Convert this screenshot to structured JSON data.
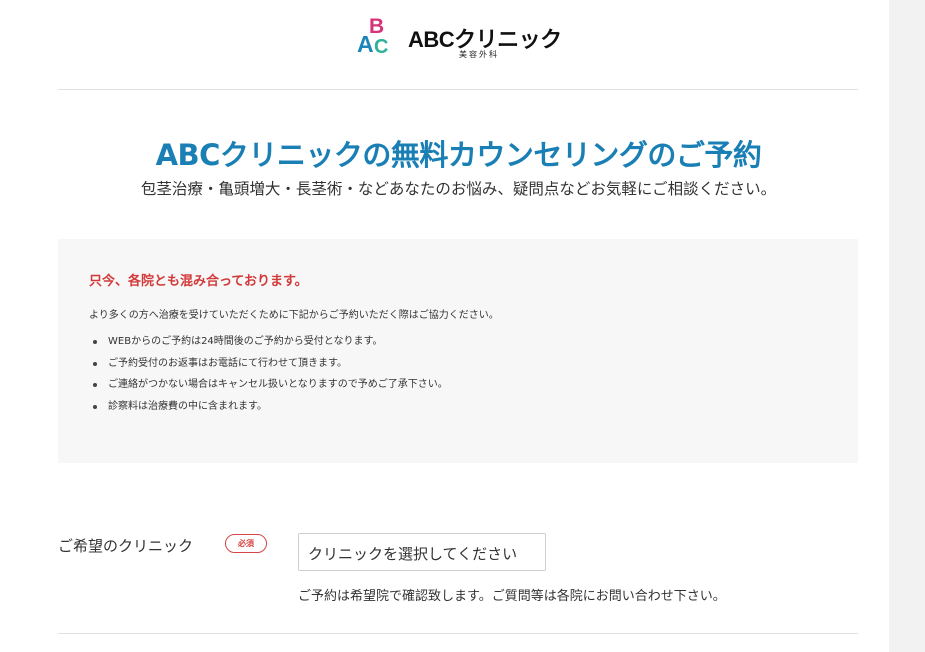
{
  "header": {
    "logo": {
      "mark_letters": [
        "B",
        "A",
        "C"
      ],
      "name": "ABCクリニック",
      "sub": "美容外科"
    }
  },
  "hero": {
    "title": "ABCクリニックの無料カウンセリングのご予約",
    "subtitle": "包茎治療・亀頭増大・長茎術・などあなたのお悩み、疑問点などお気軽にご相談ください。"
  },
  "notice": {
    "title": "只今、各院とも混み合っております。",
    "description": "より多くの方へ治療を受けていただくために下記からご予約いただく際はご協力ください。",
    "items": [
      "WEBからのご予約は24時間後のご予約から受付となります。",
      "ご予約受付のお返事はお電話にて行わせて頂きます。",
      "ご連絡がつかない場合はキャンセル扱いとなりますので予めご了承下さい。",
      "診察料は治療費の中に含まれます。"
    ]
  },
  "form": {
    "clinic": {
      "label": "ご希望のクリニック",
      "required_badge": "必須",
      "select_value": "クリニックを選択してください",
      "note": "ご予約は希望院で確認致します。ご質問等は各院にお問い合わせ下さい。"
    }
  },
  "colors": {
    "title_blue": "#1a7fb4",
    "notice_red": "#d23a3a",
    "required_red": "#d64545",
    "logo_pink": "#d6337a",
    "logo_blue": "#1c86b8",
    "logo_teal": "#2fb19a"
  }
}
